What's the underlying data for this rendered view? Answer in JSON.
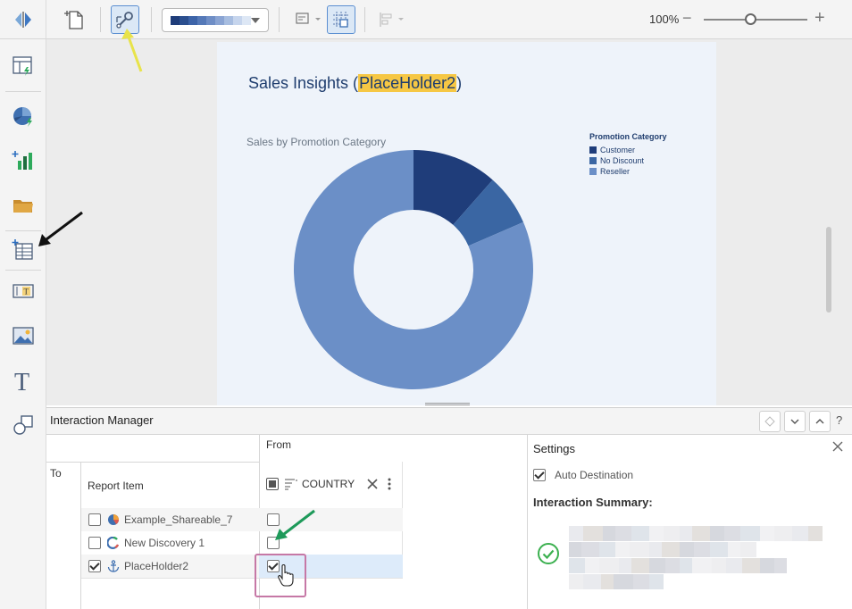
{
  "toolbar": {
    "zoom_label": "100%",
    "zoom_minus": "−",
    "zoom_plus": "+",
    "zoom_level": 0.45,
    "theme_swatches": [
      "#1f3d7a",
      "#2b4f8f",
      "#3d64a8",
      "#5579b8",
      "#6f8ec6",
      "#8aa4d3",
      "#a7bde0",
      "#c6d5ed",
      "#dde7f5"
    ]
  },
  "report": {
    "title_prefix": "Sales Insights (",
    "title_highlight": "PlaceHolder2",
    "title_suffix": ")",
    "chart_title": "Sales by Promotion Category"
  },
  "chart_data": {
    "type": "pie",
    "donut": true,
    "title": "Sales by Promotion Category",
    "legend_title": "Promotion Category",
    "legend_position": "top-right",
    "categories": [
      "Customer",
      "No Discount",
      "Reseller"
    ],
    "values": [
      11.5,
      7.0,
      81.5
    ],
    "colors": [
      "#1f3d7a",
      "#3a66a3",
      "#6b8fc7"
    ]
  },
  "interaction_manager": {
    "title": "Interaction Manager",
    "help": "?",
    "from_label": "From",
    "to_label": "To",
    "col_report_item": "Report Item",
    "col_country": "COUNTRY",
    "rows": [
      {
        "label": "Example_Shareable_7",
        "icon": "pie-chart-icon",
        "to_checked": false,
        "from_checked": false
      },
      {
        "label": "New Discovery 1",
        "icon": "discovery-icon",
        "to_checked": false,
        "from_checked": false
      },
      {
        "label": "PlaceHolder2",
        "icon": "anchor-icon",
        "to_checked": true,
        "from_checked": true
      }
    ]
  },
  "settings": {
    "title": "Settings",
    "auto_destination_label": "Auto Destination",
    "auto_destination_checked": true,
    "summary_title": "Interaction Summary:",
    "status": "success"
  }
}
